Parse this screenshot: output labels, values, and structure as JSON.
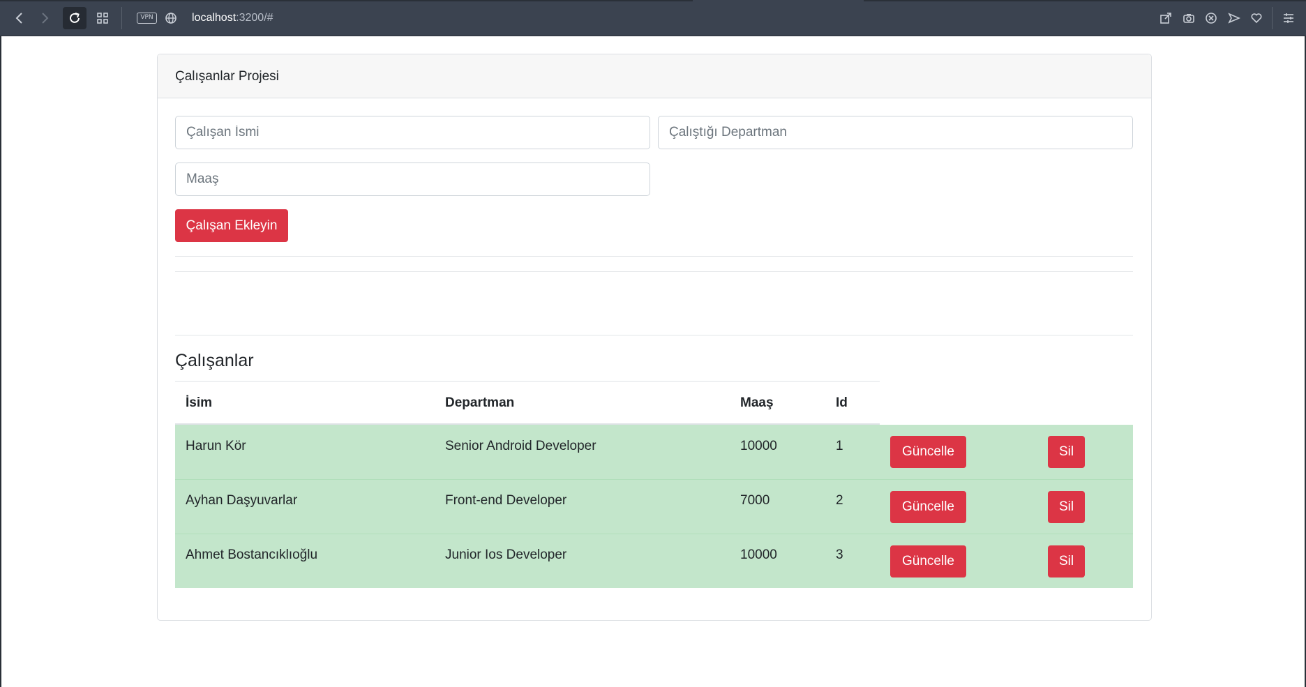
{
  "browser": {
    "url_host": "localhost",
    "url_path": ":3200/#",
    "vpn_label": "VPN",
    "icons": [
      "back-icon",
      "forward-icon",
      "reload-icon",
      "tabs-grid-icon",
      "globe-icon",
      "share-icon",
      "camera-icon",
      "close-circle-icon",
      "send-icon",
      "heart-icon",
      "menu-icon"
    ]
  },
  "card": {
    "header": "Çalışanlar Projesi"
  },
  "form": {
    "name_placeholder": "Çalışan İsmi",
    "department_placeholder": "Çalıştığı Departman",
    "salary_placeholder": "Maaş",
    "add_button": "Çalışan Ekleyin"
  },
  "table": {
    "title": "Çalışanlar",
    "headers": [
      "İsim",
      "Departman",
      "Maaş",
      "Id"
    ],
    "update_label": "Güncelle",
    "delete_label": "Sil",
    "rows": [
      {
        "name": "Harun Kör",
        "department": "Senior Android Developer",
        "salary": "10000",
        "id": "1"
      },
      {
        "name": "Ayhan Daşyuvarlar",
        "department": "Front-end Developer",
        "salary": "7000",
        "id": "2"
      },
      {
        "name": "Ahmet Bostancıklıoğlu",
        "department": "Junior Ios Developer",
        "salary": "10000",
        "id": "3"
      }
    ]
  },
  "colors": {
    "danger": "#dc3545",
    "success_row": "#c3e6cb",
    "toolbar": "#3b4350"
  }
}
